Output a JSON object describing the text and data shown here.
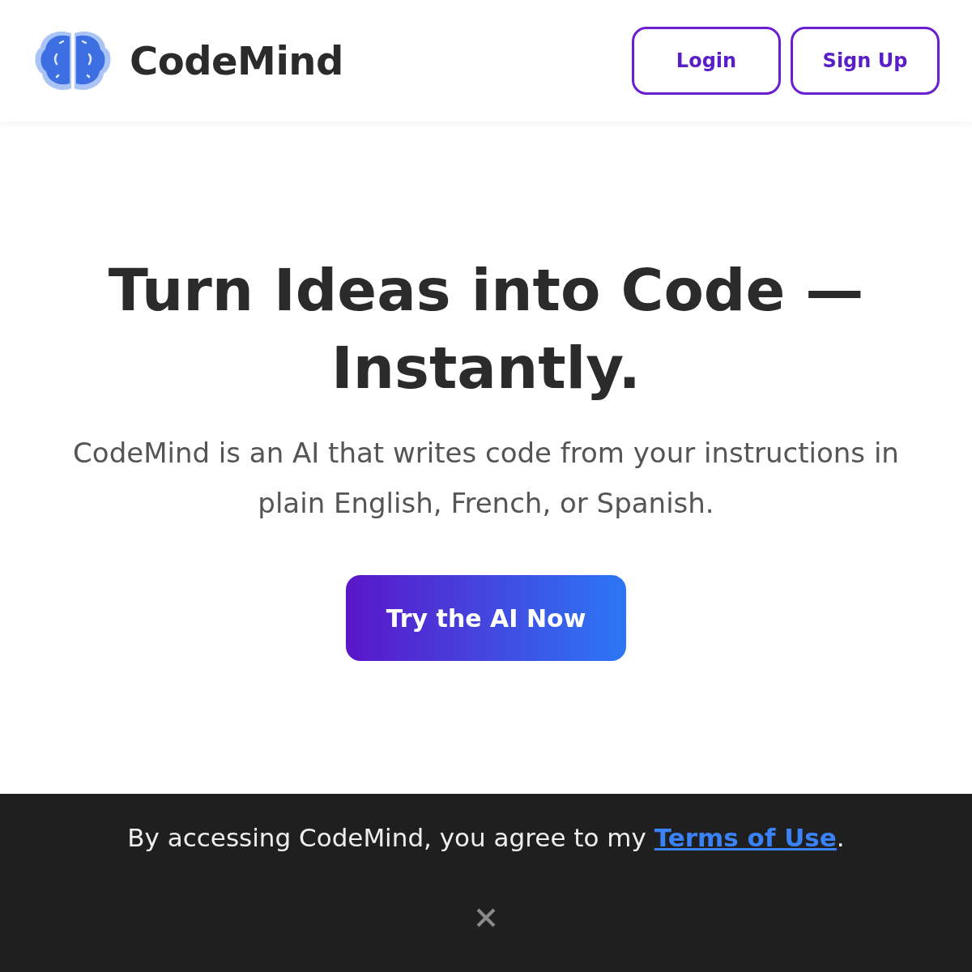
{
  "header": {
    "brand": "CodeMind",
    "buttons": [
      "Login",
      "Sign Up"
    ]
  },
  "hero": {
    "title": "Turn Ideas into Code — Instantly.",
    "subtitle": "CodeMind is an AI that writes code from your instructions in plain English, French, or Spanish.",
    "cta": "Try the AI Now"
  },
  "banner": {
    "text_before": "By accessing CodeMind, you agree to my ",
    "link": "Terms of Use",
    "text_after": "."
  }
}
